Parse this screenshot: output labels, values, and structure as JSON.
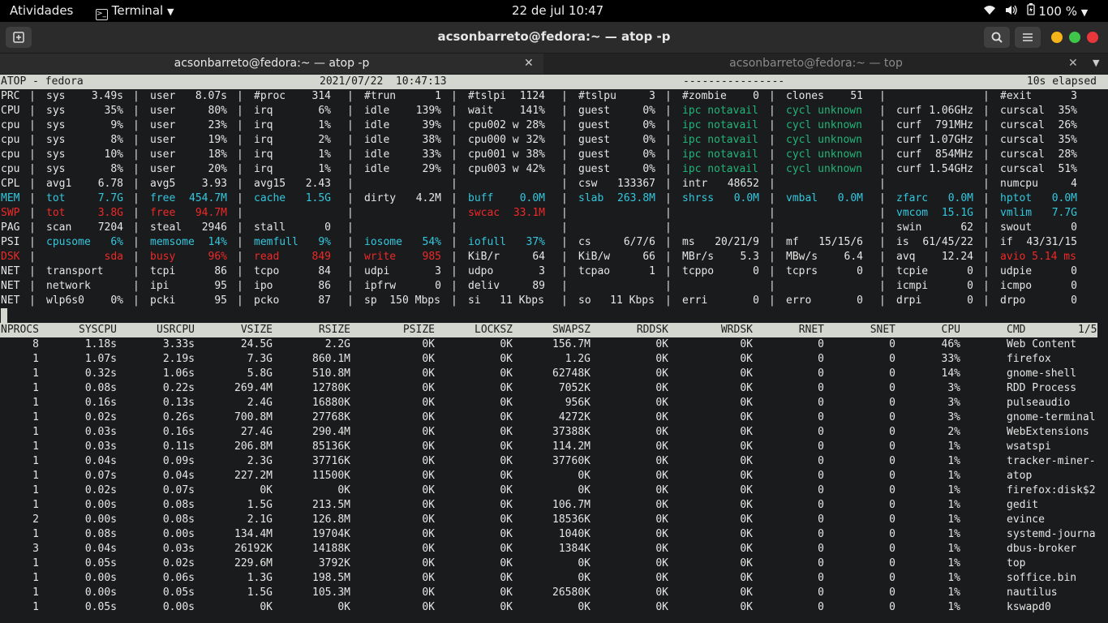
{
  "topbar": {
    "activities": "Atividades",
    "app": "Terminal",
    "clock": "22 de jul  10:47",
    "battery": "100 %"
  },
  "window": {
    "title": "acsonbarreto@fedora:~ — atop -p"
  },
  "tabs": [
    {
      "label": "acsonbarreto@fedora:~ — atop -p",
      "active": true
    },
    {
      "label": "acsonbarreto@fedora:~ — top",
      "active": false
    }
  ],
  "header": {
    "left": "ATOP - fedora",
    "date": "2021/07/22  10:47:13",
    "dashes": "----------------",
    "elapsed": "10s elapsed"
  },
  "sysrows": [
    {
      "label": "PRC",
      "fields": [
        {
          "k": "sys",
          "v": "3.49s"
        },
        {
          "k": "user",
          "v": "8.07s"
        },
        {
          "k": "#proc",
          "v": "314"
        },
        {
          "k": "#trun",
          "v": "1"
        },
        {
          "k": "#tslpi",
          "v": "1124"
        },
        {
          "k": "#tslpu",
          "v": "3"
        },
        {
          "k": "#zombie",
          "v": "0"
        },
        {
          "k": "clones",
          "v": "51"
        },
        {
          "k": "",
          "v": ""
        },
        {
          "k": "#exit",
          "v": "3"
        }
      ]
    },
    {
      "label": "CPU",
      "fields": [
        {
          "k": "sys",
          "v": "35%"
        },
        {
          "k": "user",
          "v": "80%"
        },
        {
          "k": "irq",
          "v": "6%"
        },
        {
          "k": "idle",
          "v": "139%"
        },
        {
          "k": "wait",
          "v": "141%"
        },
        {
          "k": "guest",
          "v": "0%"
        },
        {
          "k": "ipc notavail",
          "v": "",
          "c": "teal"
        },
        {
          "k": "cycl unknown",
          "v": "",
          "c": "teal"
        },
        {
          "k": "curf",
          "v": "1.06GHz"
        },
        {
          "k": "curscal",
          "v": "35%"
        }
      ]
    },
    {
      "label": "cpu",
      "fields": [
        {
          "k": "sys",
          "v": "9%"
        },
        {
          "k": "user",
          "v": "23%"
        },
        {
          "k": "irq",
          "v": "1%"
        },
        {
          "k": "idle",
          "v": "39%"
        },
        {
          "k": "cpu002 w",
          "v": "28%"
        },
        {
          "k": "guest",
          "v": "0%"
        },
        {
          "k": "ipc notavail",
          "v": "",
          "c": "teal"
        },
        {
          "k": "cycl unknown",
          "v": "",
          "c": "teal"
        },
        {
          "k": "curf",
          "v": "791MHz"
        },
        {
          "k": "curscal",
          "v": "26%"
        }
      ]
    },
    {
      "label": "cpu",
      "fields": [
        {
          "k": "sys",
          "v": "8%"
        },
        {
          "k": "user",
          "v": "19%"
        },
        {
          "k": "irq",
          "v": "2%"
        },
        {
          "k": "idle",
          "v": "38%"
        },
        {
          "k": "cpu000 w",
          "v": "32%"
        },
        {
          "k": "guest",
          "v": "0%"
        },
        {
          "k": "ipc notavail",
          "v": "",
          "c": "teal"
        },
        {
          "k": "cycl unknown",
          "v": "",
          "c": "teal"
        },
        {
          "k": "curf",
          "v": "1.07GHz"
        },
        {
          "k": "curscal",
          "v": "35%"
        }
      ]
    },
    {
      "label": "cpu",
      "fields": [
        {
          "k": "sys",
          "v": "10%"
        },
        {
          "k": "user",
          "v": "18%"
        },
        {
          "k": "irq",
          "v": "1%"
        },
        {
          "k": "idle",
          "v": "33%"
        },
        {
          "k": "cpu001 w",
          "v": "38%"
        },
        {
          "k": "guest",
          "v": "0%"
        },
        {
          "k": "ipc notavail",
          "v": "",
          "c": "teal"
        },
        {
          "k": "cycl unknown",
          "v": "",
          "c": "teal"
        },
        {
          "k": "curf",
          "v": "854MHz"
        },
        {
          "k": "curscal",
          "v": "28%"
        }
      ]
    },
    {
      "label": "cpu",
      "fields": [
        {
          "k": "sys",
          "v": "8%"
        },
        {
          "k": "user",
          "v": "20%"
        },
        {
          "k": "irq",
          "v": "1%"
        },
        {
          "k": "idle",
          "v": "29%"
        },
        {
          "k": "cpu003 w",
          "v": "42%"
        },
        {
          "k": "guest",
          "v": "0%"
        },
        {
          "k": "ipc notavail",
          "v": "",
          "c": "teal"
        },
        {
          "k": "cycl unknown",
          "v": "",
          "c": "teal"
        },
        {
          "k": "curf",
          "v": "1.54GHz"
        },
        {
          "k": "curscal",
          "v": "51%"
        }
      ]
    },
    {
      "label": "CPL",
      "fields": [
        {
          "k": "avg1",
          "v": "6.78"
        },
        {
          "k": "avg5",
          "v": "3.93"
        },
        {
          "k": "avg15",
          "v": "2.43"
        },
        {
          "k": "",
          "v": ""
        },
        {
          "k": "",
          "v": ""
        },
        {
          "k": "csw",
          "v": "133367"
        },
        {
          "k": "intr",
          "v": "48652"
        },
        {
          "k": "",
          "v": ""
        },
        {
          "k": "",
          "v": ""
        },
        {
          "k": "numcpu",
          "v": "4"
        }
      ]
    },
    {
      "label": "MEM",
      "lc": "cyan",
      "fields": [
        {
          "k": "tot",
          "v": "7.7G",
          "c": "cyan"
        },
        {
          "k": "free",
          "v": "454.7M",
          "c": "cyan"
        },
        {
          "k": "cache",
          "v": "1.5G",
          "c": "cyan"
        },
        {
          "k": "dirty",
          "v": "4.2M"
        },
        {
          "k": "buff",
          "v": "0.0M",
          "c": "cyan"
        },
        {
          "k": "slab",
          "v": "263.8M",
          "c": "cyan"
        },
        {
          "k": "shrss",
          "v": "0.0M",
          "c": "cyan"
        },
        {
          "k": "vmbal",
          "v": "0.0M",
          "c": "cyan"
        },
        {
          "k": "zfarc",
          "v": "0.0M",
          "c": "cyan"
        },
        {
          "k": "hptot",
          "v": "0.0M",
          "c": "cyan"
        }
      ]
    },
    {
      "label": "SWP",
      "lc": "red",
      "fields": [
        {
          "k": "tot",
          "v": "3.8G",
          "c": "red"
        },
        {
          "k": "free",
          "v": "94.7M",
          "c": "red"
        },
        {
          "k": "",
          "v": ""
        },
        {
          "k": "",
          "v": ""
        },
        {
          "k": "swcac",
          "v": "33.1M",
          "c": "red"
        },
        {
          "k": "",
          "v": ""
        },
        {
          "k": "",
          "v": ""
        },
        {
          "k": "",
          "v": ""
        },
        {
          "k": "vmcom",
          "v": "15.1G",
          "c": "cyan"
        },
        {
          "k": "vmlim",
          "v": "7.7G",
          "c": "cyan"
        }
      ]
    },
    {
      "label": "PAG",
      "fields": [
        {
          "k": "scan",
          "v": "7204"
        },
        {
          "k": "steal",
          "v": "2946"
        },
        {
          "k": "stall",
          "v": "0"
        },
        {
          "k": "",
          "v": ""
        },
        {
          "k": "",
          "v": ""
        },
        {
          "k": "",
          "v": ""
        },
        {
          "k": "",
          "v": ""
        },
        {
          "k": "",
          "v": ""
        },
        {
          "k": "swin",
          "v": "62"
        },
        {
          "k": "swout",
          "v": "0"
        }
      ]
    },
    {
      "label": "PSI",
      "fields": [
        {
          "k": "cpusome",
          "v": "6%",
          "c": "cyan"
        },
        {
          "k": "memsome",
          "v": "14%",
          "c": "cyan"
        },
        {
          "k": "memfull",
          "v": "9%",
          "c": "cyan"
        },
        {
          "k": "iosome",
          "v": "54%",
          "c": "cyan"
        },
        {
          "k": "iofull",
          "v": "37%",
          "c": "cyan"
        },
        {
          "k": "cs",
          "v": "6/7/6"
        },
        {
          "k": "ms",
          "v": "20/21/9"
        },
        {
          "k": "mf",
          "v": "15/15/6"
        },
        {
          "k": "is",
          "v": "61/45/22"
        },
        {
          "k": "if",
          "v": "43/31/15"
        }
      ]
    },
    {
      "label": "DSK",
      "lc": "red",
      "fields": [
        {
          "k": "",
          "v": "sda",
          "c": "red"
        },
        {
          "k": "busy",
          "v": "96%",
          "c": "red"
        },
        {
          "k": "read",
          "v": "849",
          "c": "red"
        },
        {
          "k": "write",
          "v": "985",
          "c": "red"
        },
        {
          "k": "KiB/r",
          "v": "64"
        },
        {
          "k": "KiB/w",
          "v": "66"
        },
        {
          "k": "MBr/s",
          "v": "5.3"
        },
        {
          "k": "MBw/s",
          "v": "6.4"
        },
        {
          "k": "avq",
          "v": "12.24"
        },
        {
          "k": "avio 5.14 ms",
          "v": "",
          "c": "red"
        }
      ]
    },
    {
      "label": "NET",
      "fields": [
        {
          "k": "transport",
          "v": ""
        },
        {
          "k": "tcpi",
          "v": "86"
        },
        {
          "k": "tcpo",
          "v": "84"
        },
        {
          "k": "udpi",
          "v": "3"
        },
        {
          "k": "udpo",
          "v": "3"
        },
        {
          "k": "tcpao",
          "v": "1"
        },
        {
          "k": "tcppo",
          "v": "0"
        },
        {
          "k": "tcprs",
          "v": "0"
        },
        {
          "k": "tcpie",
          "v": "0"
        },
        {
          "k": "udpie",
          "v": "0"
        }
      ]
    },
    {
      "label": "NET",
      "fields": [
        {
          "k": "network",
          "v": ""
        },
        {
          "k": "ipi",
          "v": "95"
        },
        {
          "k": "ipo",
          "v": "86"
        },
        {
          "k": "ipfrw",
          "v": "0"
        },
        {
          "k": "deliv",
          "v": "89"
        },
        {
          "k": "",
          "v": ""
        },
        {
          "k": "",
          "v": ""
        },
        {
          "k": "",
          "v": ""
        },
        {
          "k": "icmpi",
          "v": "0"
        },
        {
          "k": "icmpo",
          "v": "0"
        }
      ]
    },
    {
      "label": "NET",
      "fields": [
        {
          "k": "wlp6s0",
          "v": "0%"
        },
        {
          "k": "pcki",
          "v": "95"
        },
        {
          "k": "pcko",
          "v": "87"
        },
        {
          "k": "sp  150 Mbps",
          "v": ""
        },
        {
          "k": "si   11 Kbps",
          "v": ""
        },
        {
          "k": "so   11 Kbps",
          "v": ""
        },
        {
          "k": "erri",
          "v": "0"
        },
        {
          "k": "erro",
          "v": "0"
        },
        {
          "k": "drpi",
          "v": "0"
        },
        {
          "k": "drpo",
          "v": "0"
        }
      ]
    }
  ],
  "proc_header": [
    "NPROCS",
    "SYSCPU",
    "USRCPU",
    "VSIZE",
    "RSIZE",
    "PSIZE",
    "LOCKSZ",
    "SWAPSZ",
    "RDDSK",
    "WRDSK",
    "RNET",
    "SNET",
    "CPU",
    "CMD"
  ],
  "page_indicator": "1/5",
  "processes": [
    [
      "8",
      "1.18s",
      "3.33s",
      "24.5G",
      "2.2G",
      "0K",
      "0K",
      "156.7M",
      "0K",
      "0K",
      "0",
      "0",
      "46%",
      "Web Content"
    ],
    [
      "1",
      "1.07s",
      "2.19s",
      "7.3G",
      "860.1M",
      "0K",
      "0K",
      "1.2G",
      "0K",
      "0K",
      "0",
      "0",
      "33%",
      "firefox"
    ],
    [
      "1",
      "0.32s",
      "1.06s",
      "5.8G",
      "510.8M",
      "0K",
      "0K",
      "62748K",
      "0K",
      "0K",
      "0",
      "0",
      "14%",
      "gnome-shell"
    ],
    [
      "1",
      "0.08s",
      "0.22s",
      "269.4M",
      "12780K",
      "0K",
      "0K",
      "7052K",
      "0K",
      "0K",
      "0",
      "0",
      "3%",
      "RDD Process"
    ],
    [
      "1",
      "0.16s",
      "0.13s",
      "2.4G",
      "16880K",
      "0K",
      "0K",
      "956K",
      "0K",
      "0K",
      "0",
      "0",
      "3%",
      "pulseaudio"
    ],
    [
      "1",
      "0.02s",
      "0.26s",
      "700.8M",
      "27768K",
      "0K",
      "0K",
      "4272K",
      "0K",
      "0K",
      "0",
      "0",
      "3%",
      "gnome-terminal"
    ],
    [
      "1",
      "0.03s",
      "0.16s",
      "27.4G",
      "290.4M",
      "0K",
      "0K",
      "37388K",
      "0K",
      "0K",
      "0",
      "0",
      "2%",
      "WebExtensions"
    ],
    [
      "1",
      "0.03s",
      "0.11s",
      "206.8M",
      "85136K",
      "0K",
      "0K",
      "114.2M",
      "0K",
      "0K",
      "0",
      "0",
      "1%",
      "wsatspi"
    ],
    [
      "1",
      "0.04s",
      "0.09s",
      "2.3G",
      "37716K",
      "0K",
      "0K",
      "37760K",
      "0K",
      "0K",
      "0",
      "0",
      "1%",
      "tracker-miner-"
    ],
    [
      "1",
      "0.07s",
      "0.04s",
      "227.2M",
      "11500K",
      "0K",
      "0K",
      "0K",
      "0K",
      "0K",
      "0",
      "0",
      "1%",
      "atop"
    ],
    [
      "1",
      "0.02s",
      "0.07s",
      "0K",
      "0K",
      "0K",
      "0K",
      "0K",
      "0K",
      "0K",
      "0",
      "0",
      "1%",
      "firefox:disk$2"
    ],
    [
      "1",
      "0.00s",
      "0.08s",
      "1.5G",
      "213.5M",
      "0K",
      "0K",
      "106.7M",
      "0K",
      "0K",
      "0",
      "0",
      "1%",
      "gedit"
    ],
    [
      "2",
      "0.00s",
      "0.08s",
      "2.1G",
      "126.8M",
      "0K",
      "0K",
      "18536K",
      "0K",
      "0K",
      "0",
      "0",
      "1%",
      "evince"
    ],
    [
      "1",
      "0.08s",
      "0.00s",
      "134.4M",
      "19704K",
      "0K",
      "0K",
      "1040K",
      "0K",
      "0K",
      "0",
      "0",
      "1%",
      "systemd-journa"
    ],
    [
      "3",
      "0.04s",
      "0.03s",
      "26192K",
      "14188K",
      "0K",
      "0K",
      "1384K",
      "0K",
      "0K",
      "0",
      "0",
      "1%",
      "dbus-broker"
    ],
    [
      "1",
      "0.05s",
      "0.02s",
      "229.6M",
      "3792K",
      "0K",
      "0K",
      "0K",
      "0K",
      "0K",
      "0",
      "0",
      "1%",
      "top"
    ],
    [
      "1",
      "0.00s",
      "0.06s",
      "1.3G",
      "198.5M",
      "0K",
      "0K",
      "0K",
      "0K",
      "0K",
      "0",
      "0",
      "1%",
      "soffice.bin"
    ],
    [
      "1",
      "0.00s",
      "0.05s",
      "1.5G",
      "105.3M",
      "0K",
      "0K",
      "26580K",
      "0K",
      "0K",
      "0",
      "0",
      "1%",
      "nautilus"
    ],
    [
      "1",
      "0.05s",
      "0.00s",
      "0K",
      "0K",
      "0K",
      "0K",
      "0K",
      "0K",
      "0K",
      "0",
      "0",
      "1%",
      "kswapd0"
    ]
  ]
}
